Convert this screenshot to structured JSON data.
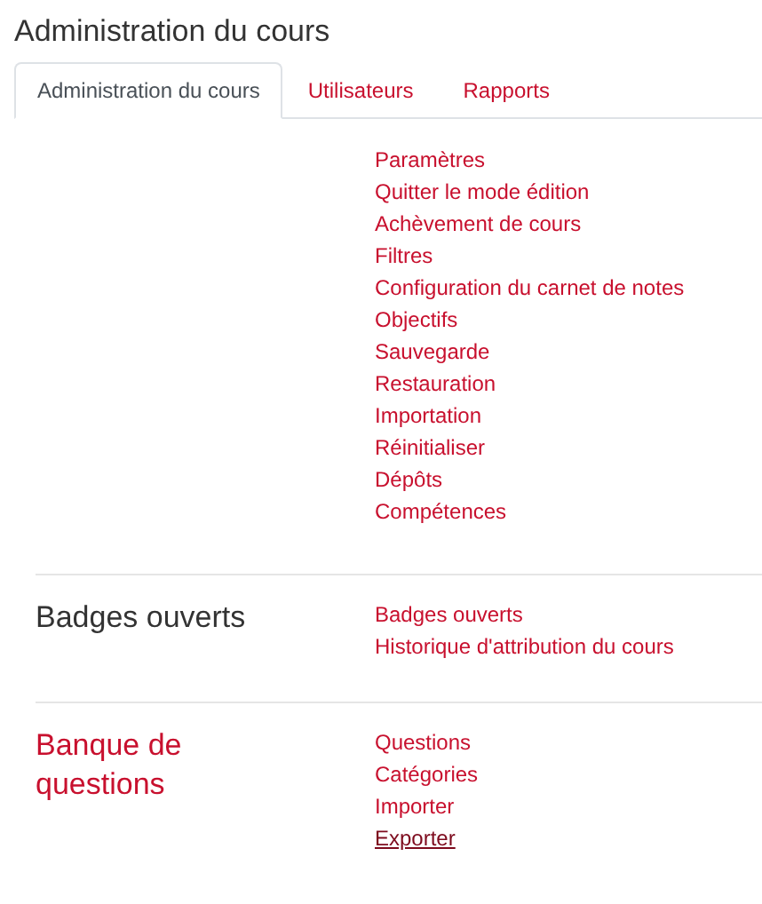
{
  "title": "Administration du cours",
  "tabs": [
    {
      "label": "Administration du cours",
      "selected": true
    },
    {
      "label": "Utilisateurs",
      "selected": false
    },
    {
      "label": "Rapports",
      "selected": false
    }
  ],
  "sections": [
    {
      "links": [
        {
          "label": "Paramètres",
          "hovered": false
        },
        {
          "label": "Quitter le mode édition",
          "hovered": false
        },
        {
          "label": "Achèvement de cours",
          "hovered": false
        },
        {
          "label": "Filtres",
          "hovered": false
        },
        {
          "label": "Configuration du carnet de notes",
          "hovered": false
        },
        {
          "label": "Objectifs",
          "hovered": false
        },
        {
          "label": "Sauvegarde",
          "hovered": false
        },
        {
          "label": "Restauration",
          "hovered": false
        },
        {
          "label": "Importation",
          "hovered": false
        },
        {
          "label": "Réinitialiser",
          "hovered": false
        },
        {
          "label": "Dépôts",
          "hovered": false
        },
        {
          "label": "Compétences",
          "hovered": false
        }
      ]
    },
    {
      "heading": {
        "text": "Badges ouverts",
        "kind": "text"
      },
      "links": [
        {
          "label": "Badges ouverts",
          "hovered": false
        },
        {
          "label": "Historique d'attribution du cours",
          "hovered": false
        }
      ]
    },
    {
      "heading": {
        "text": "Banque de questions",
        "kind": "link"
      },
      "links": [
        {
          "label": "Questions",
          "hovered": false
        },
        {
          "label": "Catégories",
          "hovered": false
        },
        {
          "label": "Importer",
          "hovered": false
        },
        {
          "label": "Exporter",
          "hovered": true
        }
      ]
    }
  ]
}
